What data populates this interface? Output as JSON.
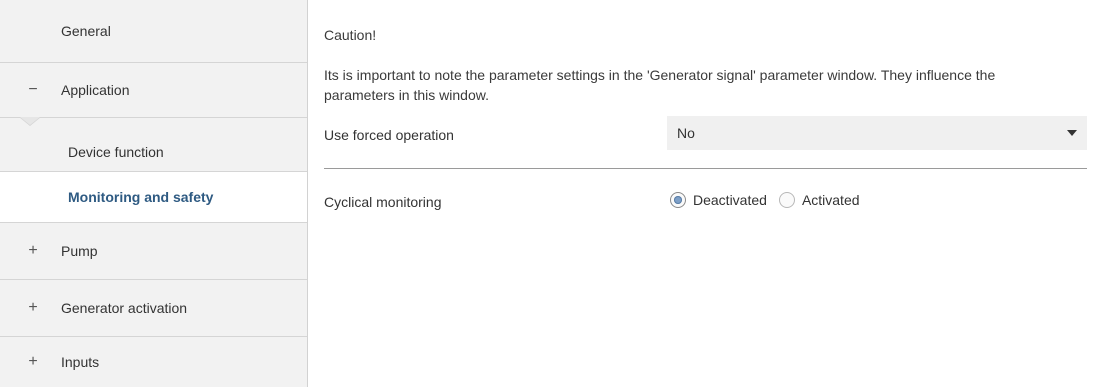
{
  "sidebar": {
    "items": [
      {
        "label": "General",
        "sign": ""
      },
      {
        "label": "Application",
        "sign": "−"
      },
      {
        "label": "Device function",
        "sign": ""
      },
      {
        "label": "Monitoring and safety",
        "sign": ""
      },
      {
        "label": "Pump",
        "sign": "+"
      },
      {
        "label": "Generator activation",
        "sign": "+"
      },
      {
        "label": "Inputs",
        "sign": "+"
      }
    ],
    "selected": "Monitoring and safety"
  },
  "main": {
    "caution_title": "Caution!",
    "caution_text": "Its is important to note the parameter settings in the 'Generator signal' parameter window. They influence the parameters in this window.",
    "forced_operation": {
      "label": "Use forced operation",
      "value": "No"
    },
    "cyclical_monitoring": {
      "label": "Cyclical monitoring",
      "options": [
        "Deactivated",
        "Activated"
      ],
      "selected": "Deactivated"
    }
  },
  "colors": {
    "sidebar_bg": "#f2f2f2",
    "selected_text": "#2e5a82",
    "dropdown_bg": "#f0f0f0",
    "radio_fill": "#7d9fc7"
  }
}
